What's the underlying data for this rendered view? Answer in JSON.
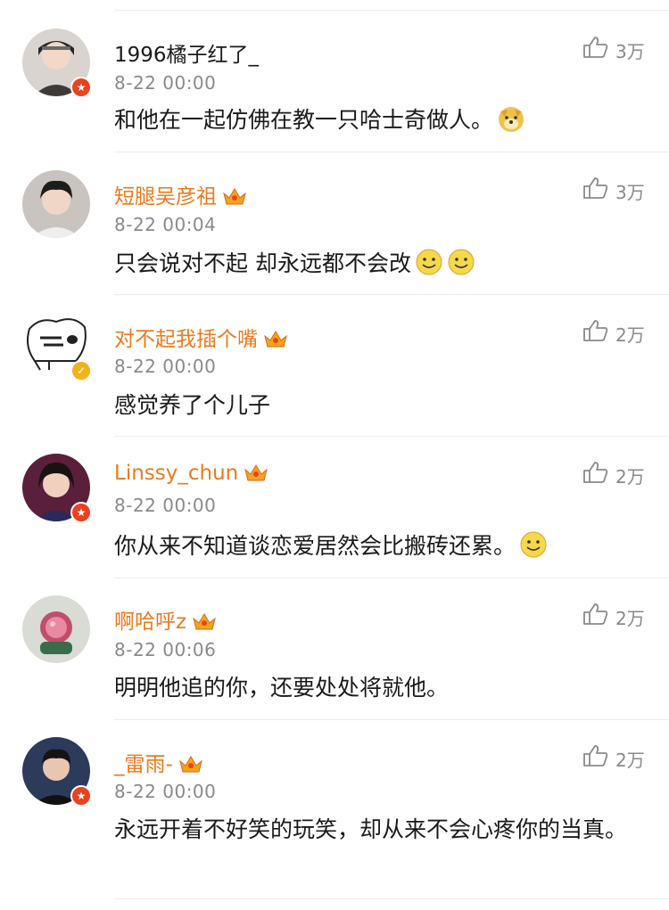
{
  "comments": [
    {
      "username": "1996橘子红了_",
      "time": "8-22 00:00",
      "text": "和他在一起仿佛在教一只哈士奇做人。",
      "likes": "3万"
    },
    {
      "username": "短腿吴彦祖",
      "time": "8-22 00:04",
      "text": "只会说对不起 却永远都不会改",
      "likes": "3万"
    },
    {
      "username": "对不起我插个嘴",
      "time": "8-22 00:00",
      "text": "感觉养了个儿子",
      "likes": "2万"
    },
    {
      "username": "Linssy_chun",
      "time": "8-22 00:00",
      "text": "你从来不知道谈恋爱居然会比搬砖还累。",
      "likes": "2万"
    },
    {
      "username": "啊哈呼z",
      "time": "8-22 00:06",
      "text": "明明他追的你，还要处处将就他。",
      "likes": "2万"
    },
    {
      "username": "_雷雨-",
      "time": "8-22 00:00",
      "text": "永远开着不好笑的玩笑，却从来不会心疼你的当真。",
      "likes": "2万"
    }
  ],
  "colors": {
    "vip_name": "#eb7a1c",
    "meta": "#8a8a8a",
    "badge_red": "#e8421f",
    "badge_gold": "#f2b21a"
  }
}
